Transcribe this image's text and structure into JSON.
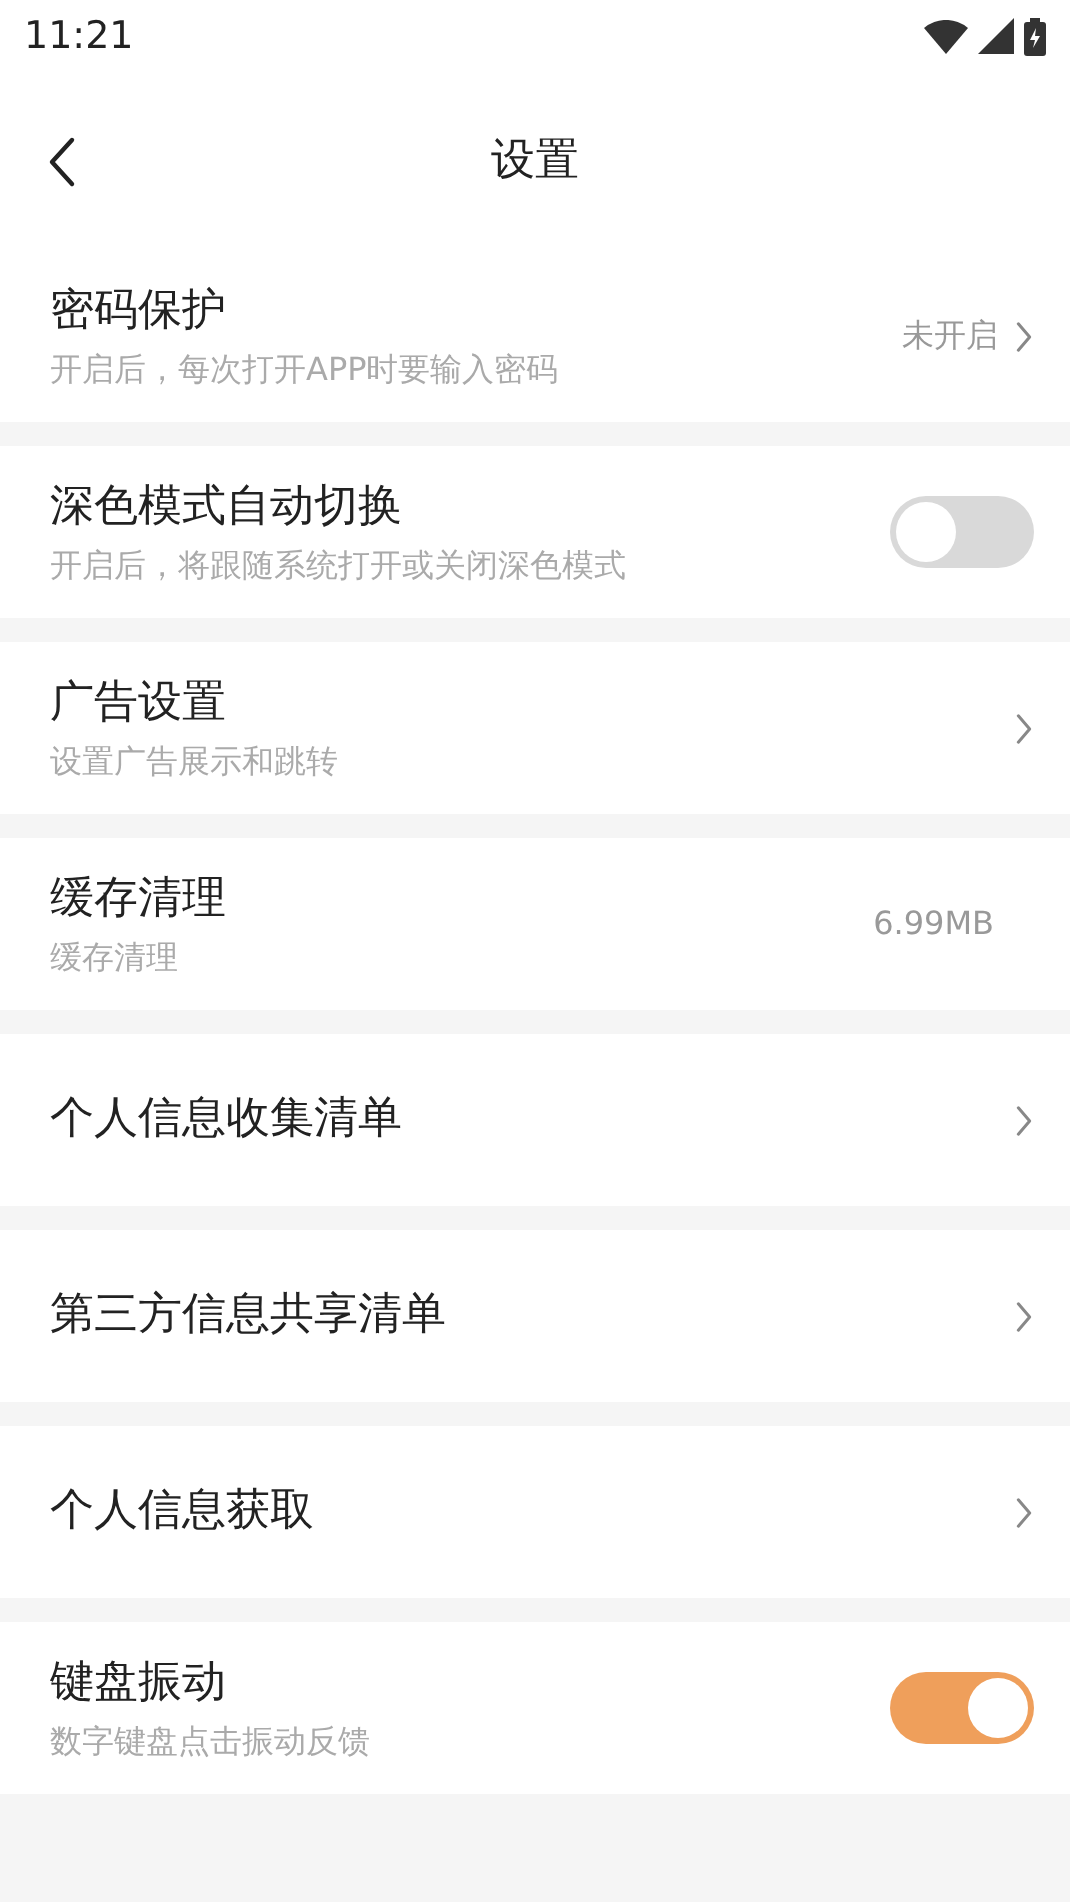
{
  "status_bar": {
    "time": "11:21"
  },
  "header": {
    "title": "设置"
  },
  "rows": [
    {
      "kind": "link",
      "title": "密码保护",
      "subtitle": "开启后，每次打开APP时要输入密码",
      "value": "未开启"
    },
    {
      "kind": "toggle",
      "title": "深色模式自动切换",
      "subtitle": "开启后，将跟随系统打开或关闭深色模式",
      "on": false
    },
    {
      "kind": "link",
      "title": "广告设置",
      "subtitle": "设置广告展示和跳转"
    },
    {
      "kind": "info",
      "title": "缓存清理",
      "subtitle": "缓存清理",
      "value": "6.99MB"
    },
    {
      "kind": "link",
      "title": "个人信息收集清单"
    },
    {
      "kind": "link",
      "title": "第三方信息共享清单"
    },
    {
      "kind": "link",
      "title": "个人信息获取"
    },
    {
      "kind": "toggle",
      "title": "键盘振动",
      "subtitle": "数字键盘点击振动反馈",
      "on": true
    }
  ]
}
